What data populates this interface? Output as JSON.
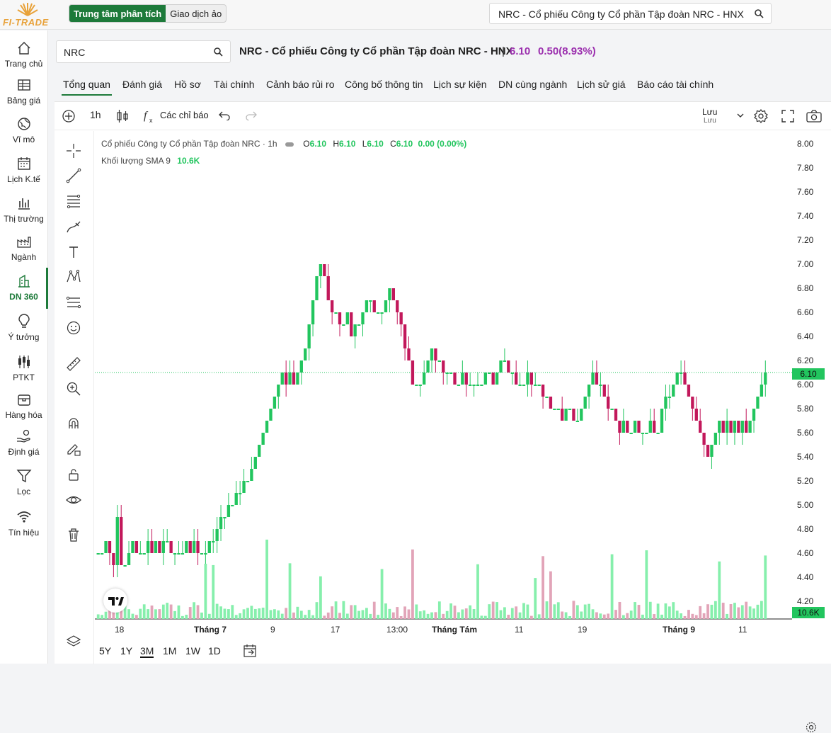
{
  "topbar": {
    "brand": "FI-TRADE",
    "mode_active": "Trung tâm phân tích",
    "mode_inactive": "Giao dịch ảo",
    "search_value": "NRC - Cổ phiếu Công ty Cổ phần Tập đoàn NRC - HNX",
    "icons": [
      "sun-logo",
      "search-icon"
    ]
  },
  "sidebar": {
    "items": [
      {
        "label": "Trang chủ",
        "icon": "home-icon"
      },
      {
        "label": "Bảng giá",
        "icon": "table-icon"
      },
      {
        "label": "Vĩ mô",
        "icon": "globe-icon"
      },
      {
        "label": "Lịch K.tế",
        "icon": "calendar-icon"
      },
      {
        "label": "Thị trường",
        "icon": "bar-chart-icon"
      },
      {
        "label": "Ngành",
        "icon": "factory-icon"
      },
      {
        "label": "DN 360",
        "icon": "building-icon",
        "active": true
      },
      {
        "label": "Ý tưởng",
        "icon": "bulb-icon"
      },
      {
        "label": "PTKT",
        "icon": "candles-icon"
      },
      {
        "label": "Hàng hóa",
        "icon": "box-icon"
      },
      {
        "label": "Định giá",
        "icon": "hand-coin-icon"
      },
      {
        "label": "Lọc",
        "icon": "filter-icon"
      },
      {
        "label": "Tín hiệu",
        "icon": "wifi-icon"
      }
    ]
  },
  "header": {
    "symbol_search": "NRC",
    "title": "NRC - Cổ phiếu Công ty Cổ phần Tập đoàn NRC - HNX",
    "separator": "|",
    "price": "6.10",
    "change": "0.50(8.93%)"
  },
  "tabs": [
    "Tổng quan",
    "Đánh giá",
    "Hồ sơ",
    "Tài chính",
    "Cảnh báo rủi ro",
    "Công bố thông tin",
    "Lịch sự kiện",
    "DN cùng ngành",
    "Lịch sử giá",
    "Báo cáo tài chính"
  ],
  "toolbar": {
    "interval": "1h",
    "indicators_label": "Các chỉ báo",
    "save_label": "Lưu",
    "save_sub": "Lưu"
  },
  "legend": {
    "title": "Cổ phiếu Công ty Cổ phần Tập đoàn NRC · 1h",
    "o_label": "O",
    "o": "6.10",
    "h_label": "H",
    "h": "6.10",
    "l_label": "L",
    "l": "6.10",
    "c_label": "C",
    "c": "6.10",
    "change": "0.00 (0.00%)",
    "volume_label": "Khối lượng SMA 9",
    "volume_value": "10.6K"
  },
  "price_badge": "6.10",
  "volume_badge": "10.6K",
  "ranges": [
    "5Y",
    "1Y",
    "3M",
    "1M",
    "1W",
    "1D"
  ],
  "active_range": "3M",
  "colors": {
    "up": "#22c55e",
    "down": "#c2185b",
    "brand": "#1d7a3a",
    "price": "#9b2fae"
  },
  "chart_data": {
    "type": "candlestick",
    "y_axis_ticks": [
      "8.00",
      "7.80",
      "7.60",
      "7.40",
      "7.20",
      "7.00",
      "6.80",
      "6.60",
      "6.40",
      "6.20",
      "6.00",
      "5.80",
      "5.60",
      "5.40",
      "5.20",
      "5.00",
      "4.80",
      "4.60",
      "4.40",
      "4.20"
    ],
    "x_axis_ticks": [
      "18",
      "Tháng 7",
      "9",
      "17",
      "13:00",
      "Tháng Tám",
      "11",
      "19",
      "Tháng 9",
      "11"
    ],
    "ylim": [
      4.1,
      8.1
    ],
    "close_path": [
      4.6,
      4.6,
      4.7,
      4.6,
      4.5,
      4.9,
      4.5,
      4.5,
      4.6,
      4.7,
      4.6,
      4.6,
      4.6,
      4.7,
      4.6,
      4.7,
      4.6,
      4.7,
      4.7,
      4.6,
      4.6,
      4.6,
      4.6,
      4.7,
      4.6,
      4.7,
      4.6,
      4.6,
      4.6,
      4.7,
      4.7,
      4.8,
      4.9,
      4.9,
      5.0,
      5.0,
      5.1,
      5.1,
      5.2,
      5.2,
      5.3,
      5.4,
      5.5,
      5.6,
      5.7,
      5.8,
      5.9,
      6.0,
      6.1,
      6.0,
      6.1,
      6.0,
      6.1,
      6.2,
      6.3,
      6.5,
      6.7,
      6.9,
      7.0,
      6.9,
      6.7,
      6.6,
      6.6,
      6.5,
      6.5,
      6.6,
      6.4,
      6.5,
      6.5,
      6.6,
      6.7,
      6.7,
      6.6,
      6.6,
      6.6,
      6.7,
      6.8,
      6.7,
      6.6,
      6.5,
      6.3,
      6.2,
      6.0,
      6.0,
      6.0,
      6.1,
      6.2,
      6.3,
      6.2,
      6.2,
      6.1,
      6.1,
      6.1,
      6.0,
      6.0,
      6.1,
      6.0,
      6.0,
      6.0,
      6.0,
      6.0,
      6.1,
      6.1,
      6.0,
      6.1,
      6.2,
      6.2,
      6.1,
      6.1,
      6.0,
      6.0,
      6.0,
      6.1,
      6.0,
      6.0,
      6.0,
      5.9,
      5.9,
      5.8,
      5.8,
      5.8,
      5.7,
      5.8,
      5.8,
      5.7,
      5.7,
      5.8,
      5.9,
      6.0,
      6.1,
      6.0,
      6.0,
      5.9,
      5.8,
      5.8,
      5.7,
      5.6,
      5.7,
      5.6,
      5.6,
      5.7,
      5.6,
      5.6,
      5.6,
      5.7,
      5.6,
      5.6,
      5.8,
      5.9,
      5.9,
      6.0,
      6.1,
      6.1,
      6.0,
      5.9,
      5.8,
      5.7,
      5.6,
      5.5,
      5.4,
      5.5,
      5.6,
      5.7,
      5.6,
      5.7,
      5.6,
      5.7,
      5.6,
      5.7,
      5.6,
      5.7,
      5.8,
      5.9,
      6.0,
      6.1
    ],
    "last_price": 6.1
  }
}
